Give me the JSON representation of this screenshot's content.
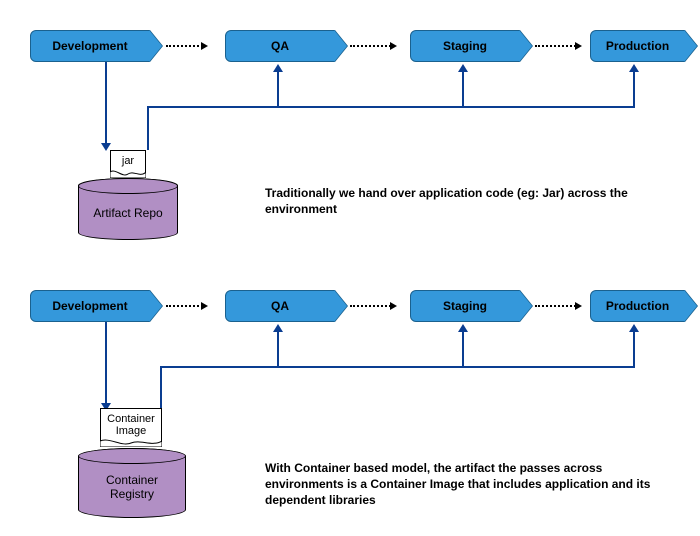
{
  "diagrams": [
    {
      "stages": [
        "Development",
        "QA",
        "Staging",
        "Production"
      ],
      "artifact_label": "jar",
      "repo_label": "Artifact Repo",
      "caption": "Traditionally we hand over application code (eg: Jar) across the environment"
    },
    {
      "stages": [
        "Development",
        "QA",
        "Staging",
        "Production"
      ],
      "artifact_label": "Container\nImage",
      "repo_label": "Container\nRegistry",
      "caption": "With Container based model, the artifact the passes across environments is a Container Image that includes application and its dependent libraries"
    }
  ]
}
